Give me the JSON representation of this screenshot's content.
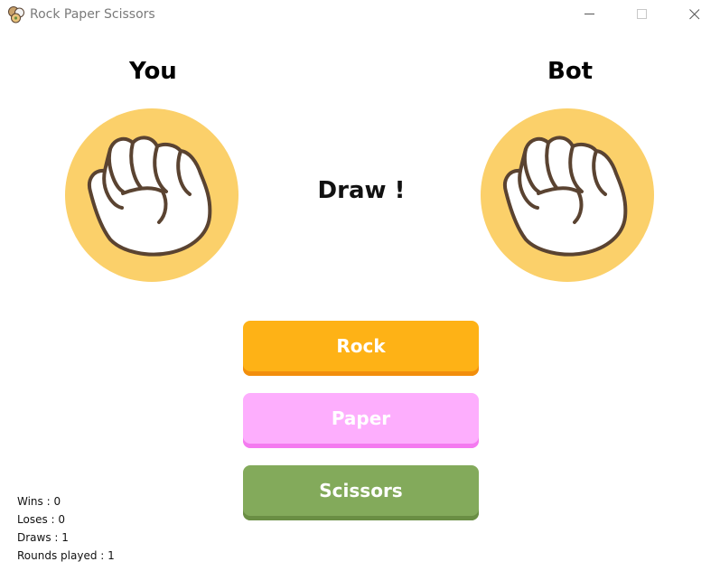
{
  "window": {
    "title": "Rock Paper Scissors",
    "app_icon": "rock-paper-scissors-icon"
  },
  "players": {
    "you_label": "You",
    "bot_label": "Bot",
    "you_choice": "rock",
    "bot_choice": "rock"
  },
  "result": "Draw !",
  "buttons": {
    "rock": "Rock",
    "paper": "Paper",
    "scissors": "Scissors"
  },
  "stats": {
    "wins": "Wins : 0",
    "loses": "Loses : 0",
    "draws": "Draws : 1",
    "rounds": "Rounds played : 1"
  },
  "colors": {
    "circle": "#fbd06a",
    "rock_button": "#feb216",
    "paper_button": "#fdaefd",
    "scissors_button": "#83aa5b"
  }
}
